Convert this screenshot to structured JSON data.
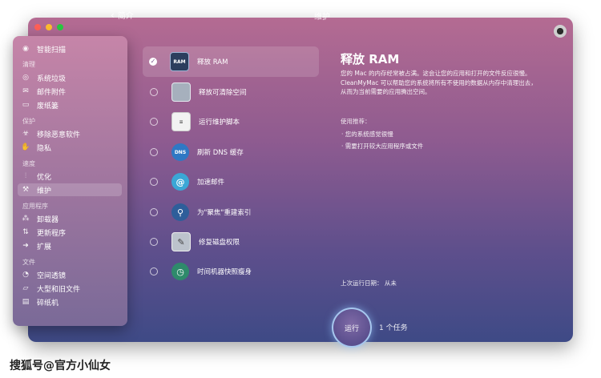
{
  "window": {
    "back_label": "简介",
    "section_title": "维护"
  },
  "sidebar": {
    "sections": [
      {
        "header": ""
      },
      {
        "header": "清理"
      },
      {
        "header": "保护"
      },
      {
        "header": "速度"
      },
      {
        "header": "应用程序"
      },
      {
        "header": "文件"
      }
    ],
    "items": [
      {
        "label": "智能扫描",
        "icon": "smart-scan-icon"
      },
      {
        "label": "系统垃圾",
        "icon": "system-junk-icon"
      },
      {
        "label": "邮件附件",
        "icon": "mail-icon"
      },
      {
        "label": "废纸篓",
        "icon": "trash-icon"
      },
      {
        "label": "移除恶意软件",
        "icon": "biohazard-icon"
      },
      {
        "label": "隐私",
        "icon": "hand-icon"
      },
      {
        "label": "优化",
        "icon": "sliders-icon"
      },
      {
        "label": "维护",
        "icon": "wrench-icon"
      },
      {
        "label": "卸载器",
        "icon": "uninstaller-icon"
      },
      {
        "label": "更新程序",
        "icon": "updater-icon"
      },
      {
        "label": "扩展",
        "icon": "extensions-icon"
      },
      {
        "label": "空间透镜",
        "icon": "space-lens-icon"
      },
      {
        "label": "大型和旧文件",
        "icon": "folder-icon"
      },
      {
        "label": "碎纸机",
        "icon": "shredder-icon"
      }
    ]
  },
  "tasks": [
    {
      "label": "释放 RAM",
      "checked": true,
      "icon": "ram-icon",
      "icon_text": "RAM"
    },
    {
      "label": "释放可清除空间",
      "checked": false,
      "icon": "disk-icon",
      "icon_text": ""
    },
    {
      "label": "运行维护脚本",
      "checked": false,
      "icon": "script-icon",
      "icon_text": ""
    },
    {
      "label": "刷新 DNS 缓存",
      "checked": false,
      "icon": "dns-icon",
      "icon_text": "DNS"
    },
    {
      "label": "加速邮件",
      "checked": false,
      "icon": "mail-speed-icon",
      "icon_text": ""
    },
    {
      "label": "为\"聚焦\"重建索引",
      "checked": false,
      "icon": "spotlight-icon",
      "icon_text": ""
    },
    {
      "label": "修复磁盘权限",
      "checked": false,
      "icon": "permissions-icon",
      "icon_text": ""
    },
    {
      "label": "时间机器快照瘦身",
      "checked": false,
      "icon": "time-machine-icon",
      "icon_text": ""
    }
  ],
  "detail": {
    "title": "释放 RAM",
    "desc_lines": [
      "您的 Mac 的内存经常被占满。这会让您的应用和打开的文件反应很慢。",
      "CleanMyMac 可以帮助您的系统将所有不使用的数据从内存中清理出去，",
      "从而为当前需要的应用腾出空间。"
    ],
    "recommend_title": "使用推荐：",
    "recommend_items": [
      "您的系统感觉很慢",
      "需要打开较大应用程序或文件"
    ],
    "last_run": "上次运行日期：  从未"
  },
  "footer": {
    "run_label": "运行",
    "task_count": "1 个任务"
  },
  "watermark": "搜狐号@官方小仙女"
}
